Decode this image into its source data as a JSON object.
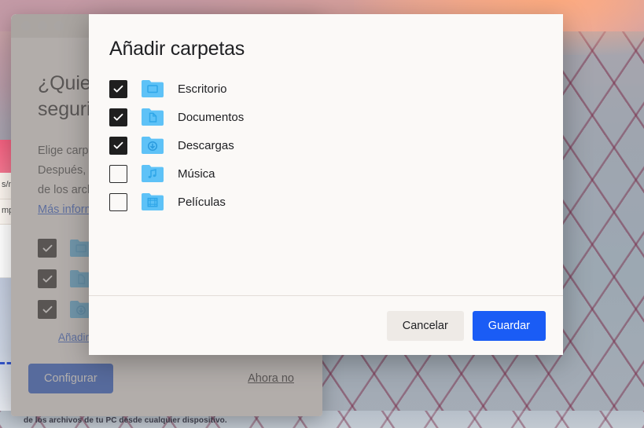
{
  "desktop": {
    "wallpaper_name": "sunset-lattice-wallpaper",
    "sky_color": "#f0a98f",
    "lattice_color": "#78284 6"
  },
  "background_browser": {
    "tab_label": "s/n",
    "row_label": "mp"
  },
  "app_window": {
    "traffic_lights": [
      "close-button",
      "minimize-button",
      "maximize-button"
    ],
    "heading_line1": "¿Quiero",
    "heading_line2": "seguric",
    "body_line1": "Elige carpet",
    "body_line2": "Después, po",
    "body_line3": "de los archiv",
    "link_label": "Más informa",
    "folders": [
      {
        "label": "",
        "checked": true,
        "icon": "folder-desktop-icon"
      },
      {
        "label": "",
        "checked": true,
        "icon": "folder-documents-icon"
      },
      {
        "label": "",
        "checked": true,
        "icon": "folder-downloads-icon"
      }
    ],
    "add_folders_link": "Añadir c",
    "primary_button": "Configurar",
    "secondary_button": "Ahora no"
  },
  "page_caption": "de los archivos de tu PC desde cualquier dispositivo.",
  "modal": {
    "title": "Añadir carpetas",
    "folders": [
      {
        "label": "Escritorio",
        "checked": true,
        "icon": "folder-desktop-icon"
      },
      {
        "label": "Documentos",
        "checked": true,
        "icon": "folder-documents-icon"
      },
      {
        "label": "Descargas",
        "checked": true,
        "icon": "folder-downloads-icon"
      },
      {
        "label": "Música",
        "checked": false,
        "icon": "folder-music-icon"
      },
      {
        "label": "Películas",
        "checked": false,
        "icon": "folder-movies-icon"
      }
    ],
    "cancel_label": "Cancelar",
    "save_label": "Guardar",
    "accent_color": "#1a5cf5"
  }
}
